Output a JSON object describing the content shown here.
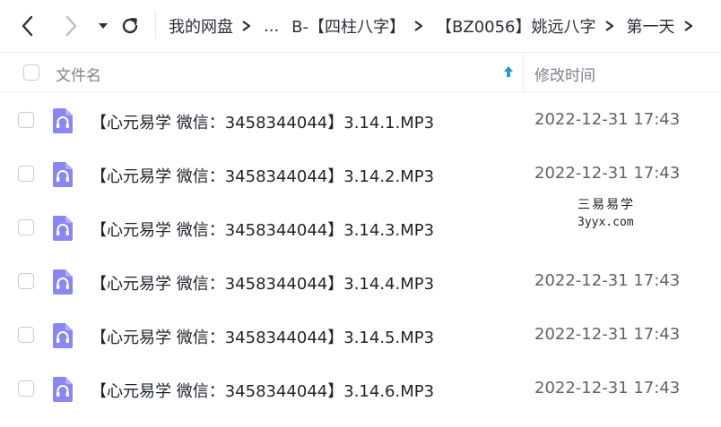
{
  "toolbar": {
    "icons": [
      "back-arrow-icon",
      "forward-arrow-icon",
      "dropdown-caret-icon",
      "refresh-icon"
    ]
  },
  "breadcrumb": {
    "items": [
      "我的网盘",
      "...",
      "B-【四柱八字】",
      "【BZ0056】姚远八字",
      "第一天"
    ],
    "separator_icon": "chevron-right-icon"
  },
  "file_list": {
    "header": {
      "name": "文件名",
      "modified": "修改时间",
      "sort_icon": "sort-up-arrow-icon"
    },
    "rows": [
      {
        "name": "【心元易学 微信：3458344044】3.14.1.MP3",
        "modified": "2022-12-31 17:43"
      },
      {
        "name": "【心元易学 微信：3458344044】3.14.2.MP3",
        "modified": "2022-12-31 17:43"
      },
      {
        "name": "【心元易学 微信：3458344044】3.14.3.MP3",
        "modified": ""
      },
      {
        "name": "【心元易学 微信：3458344044】3.14.4.MP3",
        "modified": "2022-12-31 17:43"
      },
      {
        "name": "【心元易学 微信：3458344044】3.14.5.MP3",
        "modified": "2022-12-31 17:43"
      },
      {
        "name": "【心元易学 微信：3458344044】3.14.6.MP3",
        "modified": "2022-12-31 17:43"
      }
    ],
    "file_icon": "audio-file-icon"
  },
  "watermark": {
    "line1": "三易易学",
    "line2": "3yyx.com"
  },
  "colors": {
    "accent": "#1e8fe1",
    "audio_icon": "#8b87f2",
    "audio_icon_light": "#b2aefa"
  }
}
